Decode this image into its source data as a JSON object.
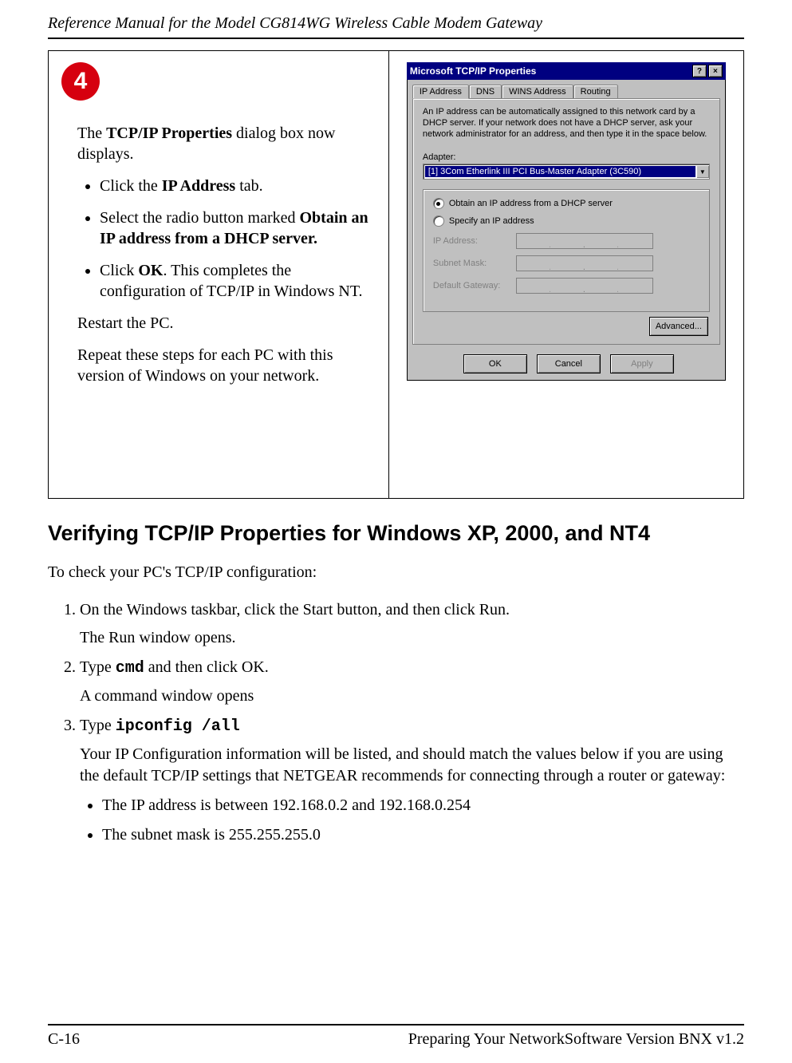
{
  "header": {
    "title": "Reference Manual for the Model CG814WG Wireless Cable Modem Gateway"
  },
  "step": {
    "number": "4",
    "intro_pre": "The ",
    "intro_bold": "TCP/IP Properties",
    "intro_post": " dialog box now displays.",
    "bullets": {
      "b1_pre": "Click the ",
      "b1_bold": "IP Address",
      "b1_post": " tab.",
      "b2_pre": "Select the radio button marked ",
      "b2_bold": "Obtain an IP address from a DHCP server.",
      "b3_pre": "Click ",
      "b3_bold": "OK",
      "b3_post": ".  This completes the configuration of TCP/IP in Windows NT."
    },
    "restart": "Restart the PC.",
    "repeat": "Repeat these steps for each PC with this version of Windows on your network."
  },
  "dialog": {
    "title": "Microsoft TCP/IP Properties",
    "help_btn": "?",
    "close_btn": "×",
    "tabs": {
      "ip": "IP Address",
      "dns": "DNS",
      "wins": "WINS Address",
      "routing": "Routing"
    },
    "desc": "An IP address can be automatically assigned to this network card by a DHCP server.  If your network does not have a DHCP server, ask your network administrator for an address, and then type it in the space below.",
    "adapter_label": "Adapter:",
    "adapter_value": "[1] 3Com Etherlink III PCI Bus-Master Adapter (3C590)",
    "radio_dhcp": "Obtain an IP address from a DHCP server",
    "radio_specify": "Specify an IP address",
    "fields": {
      "ip": "IP Address:",
      "mask": "Subnet Mask:",
      "gw": "Default Gateway:"
    },
    "advanced": "Advanced...",
    "ok": "OK",
    "cancel": "Cancel",
    "apply": "Apply"
  },
  "section": {
    "heading": "Verifying TCP/IP Properties for Windows XP, 2000, and NT4",
    "intro": "To check your PC's TCP/IP configuration:",
    "s1": "On the Windows taskbar, click the Start button, and then click Run.",
    "s1b": "The Run window opens.",
    "s2_pre": "Type ",
    "s2_code": "cmd",
    "s2_post": " and then click OK.",
    "s2b": "A command window opens",
    "s3_pre": "Type ",
    "s3_code": "ipconfig /all",
    "s3b": "Your IP Configuration information will be listed, and should match the values below if you are using the default TCP/IP settings that NETGEAR recommends for connecting through a router or gateway:",
    "s3_li1": "The IP address is between 192.168.0.2 and 192.168.0.254",
    "s3_li2": "The subnet mask is 255.255.255.0"
  },
  "footer": {
    "left": "C-16",
    "right": "Preparing Your NetworkSoftware Version BNX v1.2"
  }
}
